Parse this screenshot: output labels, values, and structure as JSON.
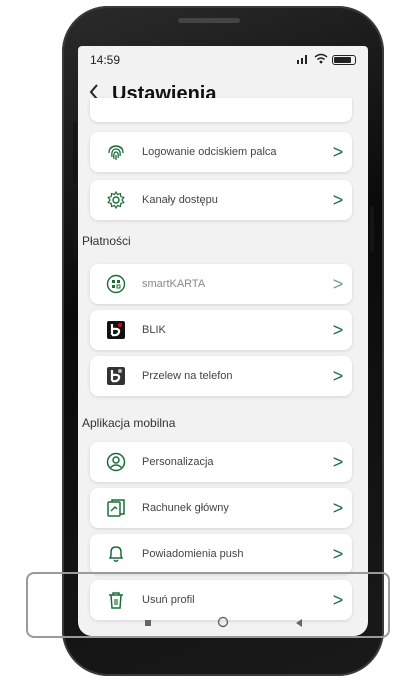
{
  "status": {
    "time": "14:59",
    "signal": "⁴ₗₗₗ",
    "wifi": "wifi"
  },
  "header": {
    "back": "<",
    "title": "Ustawienia"
  },
  "colors": {
    "accent": "#1a6e3a",
    "background": "#f2f2f2"
  },
  "security": {
    "items": [
      {
        "label": "Logowanie odciskiem palca",
        "icon": "fingerprint-icon"
      },
      {
        "label": "Kanały dostępu",
        "icon": "gear-icon"
      }
    ]
  },
  "payments": {
    "heading": "Płatności",
    "items": [
      {
        "label": "smartKARTA",
        "icon": "card-icon"
      },
      {
        "label": "BLIK",
        "icon": "blik-icon"
      },
      {
        "label": "Przelew na telefon",
        "icon": "blik-phone-icon"
      }
    ]
  },
  "mobile_app": {
    "heading": "Aplikacja mobilna",
    "items": [
      {
        "label": "Personalizacja",
        "icon": "user-icon"
      },
      {
        "label": "Rachunek główny",
        "icon": "account-icon"
      },
      {
        "label": "Powiadomienia push",
        "icon": "bell-icon"
      },
      {
        "label": "Usuń profil",
        "icon": "trash-icon"
      }
    ]
  },
  "chevron": ">"
}
